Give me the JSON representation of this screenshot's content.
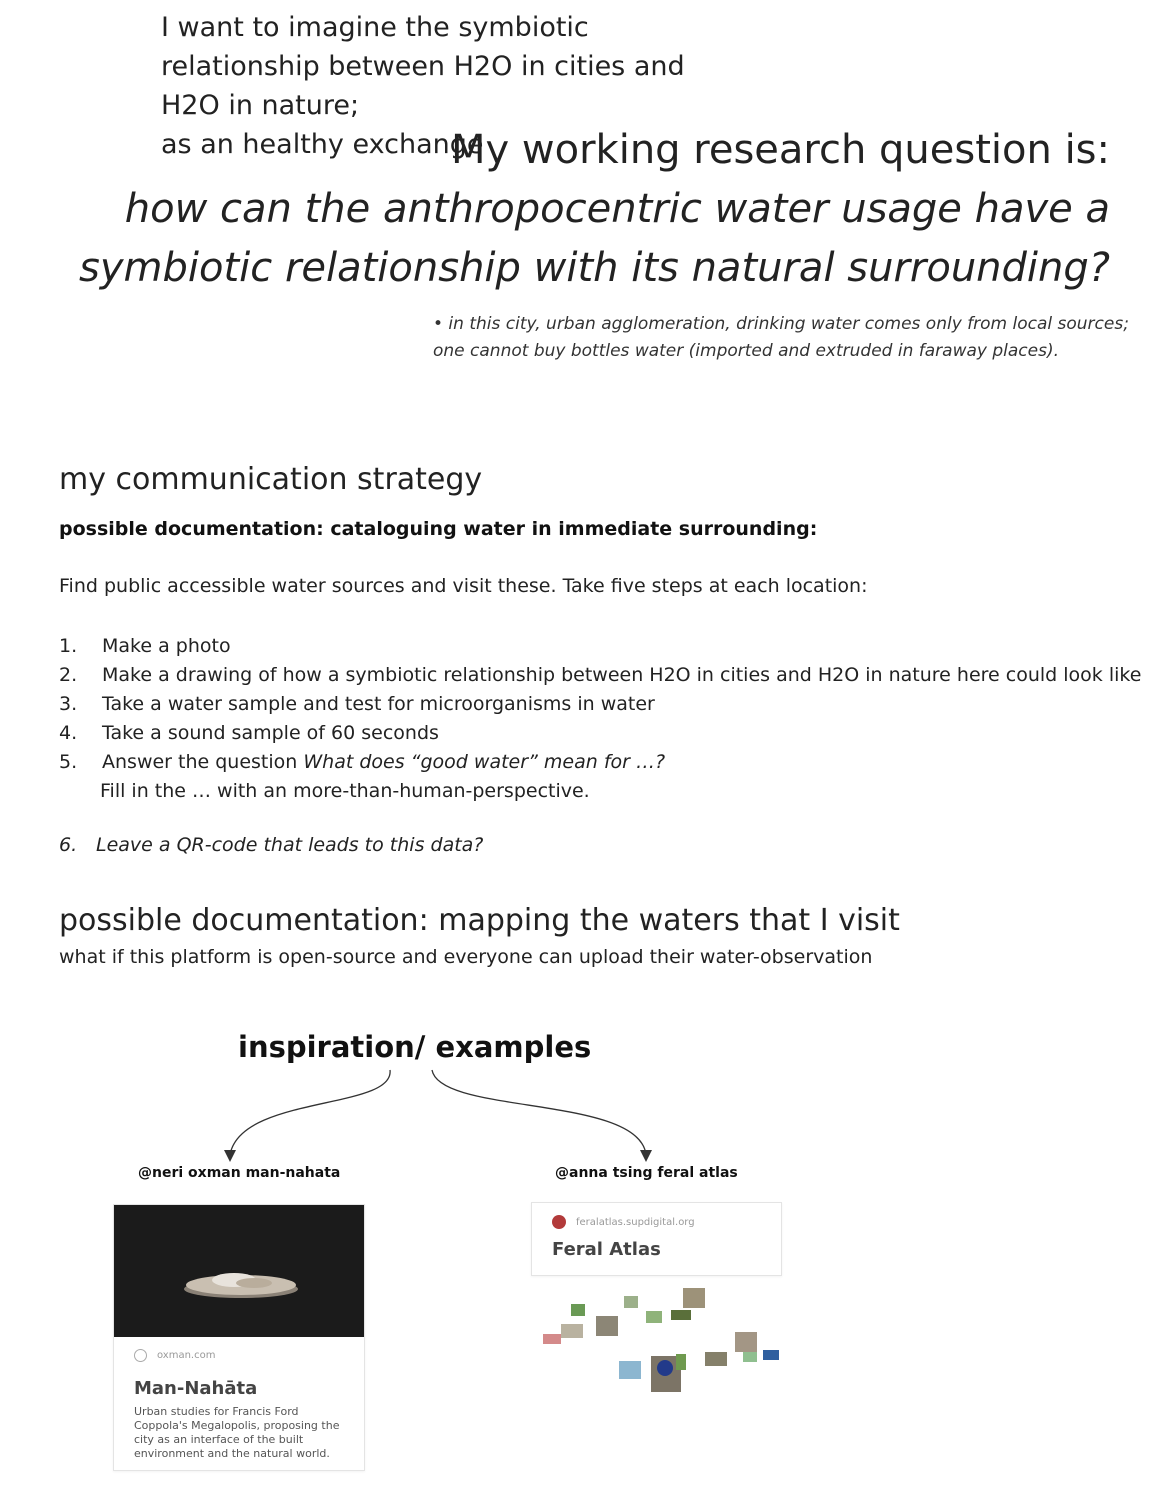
{
  "intro": {
    "lines": [
      "I want to imagine the symbiotic",
      "relationship between H2O in cities and",
      "H2O in nature;",
      "as an healthy exchange"
    ]
  },
  "research": {
    "heading": "My working research question is:",
    "question_lines": [
      "how can the anthropocentric water usage have a",
      "symbiotic relationship with its natural surrounding?"
    ],
    "note_lines": [
      "• in this city, urban agglomeration, drinking water comes only from local sources;",
      "one cannot buy bottles water (imported and extruded in faraway places)."
    ]
  },
  "strategy": {
    "heading": "my communication strategy",
    "subheading": "possible documentation: cataloguing water in immediate surrounding:",
    "intro": "Find public accessible water sources and visit these. Take five steps at each location:",
    "steps": [
      {
        "num": "1.",
        "text": "Make a photo"
      },
      {
        "num": "2.",
        "text": "Make a drawing of how a symbiotic relationship between H2O in cities and H2O in nature here could look like"
      },
      {
        "num": "3.",
        "text": "Take a water sample and test for microorganisms in water"
      },
      {
        "num": "4.",
        "text": "Take a sound sample of 60 seconds"
      },
      {
        "num": "5.",
        "text": "Answer the question ",
        "italic": "What does “good water” mean for …?"
      }
    ],
    "step5_continuation": "Fill in the … with an more-than-human-perspective.",
    "step6_num": "6.",
    "step6_text": "Leave a QR-code that leads to this data?"
  },
  "mapping": {
    "heading": "possible documentation: mapping the waters that I visit",
    "subtext": "what if this platform is open-source and everyone can upload their water-observation"
  },
  "inspiration": {
    "heading": "inspiration/ examples",
    "left": {
      "handle": "@neri oxman man-nahata",
      "domain": "oxman.com",
      "title": "Man-Nahāta",
      "description": "Urban studies for Francis Ford Coppola's Megalopolis, proposing the city as an interface of the built environment and the natural world."
    },
    "right": {
      "handle": "@anna tsing feral atlas",
      "domain": "feralatlas.supdigital.org",
      "title": "Feral Atlas"
    }
  }
}
